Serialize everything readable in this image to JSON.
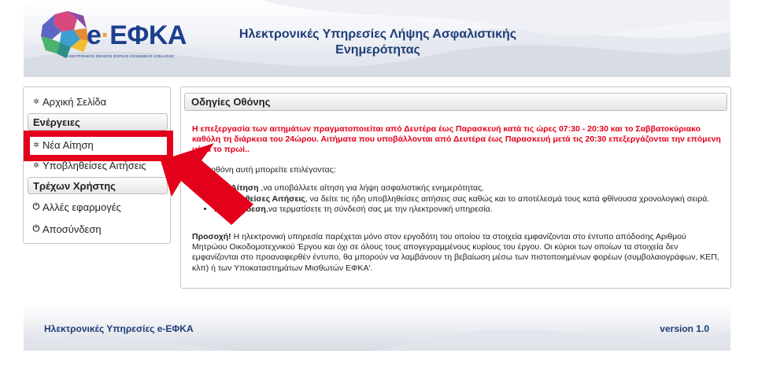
{
  "header": {
    "logo_text_prefix": "e",
    "logo_text_dot": "·",
    "logo_text_main": "ΕΦΚΑ",
    "logo_subtitle": "ΗΛΕΚΤΡΟΝΙΚΟΣ ΕΘΝΙΚΟΣ ΦΟΡΕΑΣ ΚΟΙΝΩΝΙΚΗΣ ΑΣΦΑΛΙΣΗΣ",
    "title_line1": "Ηλεκτρονικές Υπηρεσίες Λήψης Ασφαλιστικής",
    "title_line2": "Ενημερότητας"
  },
  "sidebar": {
    "home_label": "Αρχική Σελίδα",
    "actions_heading": "Ενέργειες",
    "new_request_label": "Νέα Αίτηση",
    "submitted_requests_label": "Υποβληθείσες Αιτήσεις",
    "current_user_heading": "Τρέχων Χρήστης",
    "other_apps_label": "Αλλές εφαρμογές",
    "logout_label": "Αποσύνδεση"
  },
  "main": {
    "heading": "Οδηγίες Οθόνης",
    "warning": "Η επεξεργασία των αιτημάτων πραγματοποιείται από Δευτέρα έως Παρασκευή κατά τις ώρες 07:30 - 20:30 και το Σαββατοκύριακο καθόλη τη διάρκεια του 24ώρου. Αιτήματα που υποβάλλονται από Δευτέρα έως Παρασκευή μετά τις 20:30 επεξεργάζονται την επόμενη μέρα το πρωί..",
    "intro": "Στην οθόνη αυτή μπορείτε επιλέγοντας:",
    "bullets": [
      {
        "term": "Νέα Αίτηση",
        "text": " ,να υποβάλλετε αίτηση για λήψη ασφαλιστικής ενημερότητας."
      },
      {
        "term": "Υποβληθείσες Αιτήσεις",
        "text": ", να δείτε τις ήδη υποβληθείσες αιτήσεις σας καθώς και το αποτέλεσμά τους κατά φθίνουσα χρονολογική σειρά."
      },
      {
        "term": "Αποσύνδεση",
        "text": ",να τερματίσετε τη σύνδεσή σας με την ηλεκτρονική υπηρεσία."
      }
    ],
    "note_label": "Προσοχή!",
    "note_text": " Η ηλεκτρονική υπηρεσία παρέχεται μόνο στον εργοδότη του οποίου τα στοιχεία εμφανίζονται στο έντυπο απόδοσης Αριθμού Μητρώου Οικοδομοτεχνικού Έργου και όχι σε όλους τους απογεγραμμένους κυρίους του έργου. Οι κύριοι των οποίων τα στοιχεία δεν εμφανίζονται στο προαναφερθέν έντυπο, θα μπορούν να λαμβάνουν τη βεβαίωση μέσω των πιστοποιημένων φορέων (συμβολαιογράφων, ΚΕΠ, κλπ) ή των Υποκαταστημάτων Μισθωτών ΕΦΚΑ'."
  },
  "footer": {
    "left_text": "Ηλεκτρονικές Υπηρεσίες e-ΕΦΚΑ",
    "right_text": "version 1.0"
  },
  "icons": {
    "gear": "gear-icon",
    "power": "power-icon"
  },
  "colors": {
    "brand_blue": "#1e3c78",
    "warning_red": "#e3001b",
    "highlight_red": "#e3001b"
  }
}
